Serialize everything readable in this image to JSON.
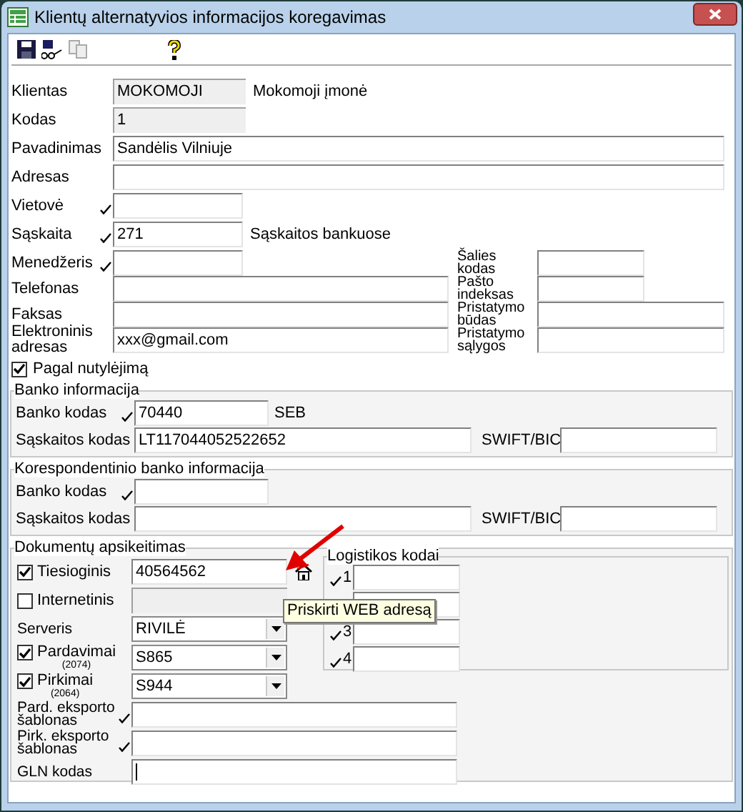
{
  "window": {
    "title": "Klientų alternatyvios informacijos koregavimas"
  },
  "main_fields": [
    {
      "label": "Klientas",
      "value": "MOKOMOJI",
      "disabled": true,
      "lookup": false,
      "note": "Mokomoji įmonė"
    },
    {
      "label": "Kodas",
      "value": "1",
      "disabled": true,
      "lookup": false
    },
    {
      "label": "Pavadinimas",
      "value": "Sandėlis Vilniuje",
      "disabled": false,
      "lookup": false
    },
    {
      "label": "Adresas",
      "disabled": false,
      "lookup": false
    },
    {
      "label": "Vietovė",
      "disabled": false,
      "lookup": true
    },
    {
      "label": "Sąskaita",
      "value": "271",
      "disabled": false,
      "lookup": true,
      "note": "Sąskaitos bankuose"
    }
  ],
  "left_fields": [
    {
      "label": "Menedžeris",
      "lookup": true
    },
    {
      "label": "Telefonas",
      "lookup": false
    },
    {
      "label": "Faksas",
      "lookup": false
    },
    {
      "label": "Elektroninis adresas",
      "value": "xxx@gmail.com",
      "lookup": false
    }
  ],
  "right_fields": [
    {
      "label": "Šalies kodas"
    },
    {
      "label": "Pašto indeksas"
    },
    {
      "label": "Pristatymo būdas"
    },
    {
      "label": "Pristatymo sąlygos"
    }
  ],
  "default_checkbox": {
    "label": "Pagal nutylėjimą",
    "checked": true
  },
  "bank_groups": [
    {
      "title": "Banko informacija",
      "bank_code": {
        "label": "Banko kodas",
        "value": "70440",
        "lookup": true,
        "note": "SEB"
      },
      "account": {
        "label": "Sąskaitos kodas",
        "value": "LT117044052522652"
      },
      "swift": {
        "label": "SWIFT/BIC"
      }
    },
    {
      "title": "Korespondentinio banko informacija",
      "bank_code": {
        "label": "Banko kodas",
        "lookup": true
      },
      "account": {
        "label": "Sąskaitos kodas"
      },
      "swift": {
        "label": "SWIFT/BIC"
      }
    }
  ],
  "documents": {
    "title": "Dokumentų apsikeitimas",
    "rows": [
      {
        "kind": "check",
        "label": "Tiesioginis",
        "checked": true,
        "value": "40564562",
        "disabled": false,
        "web_button": true
      },
      {
        "kind": "check",
        "label": "Internetinis",
        "checked": false,
        "disabled": true,
        "web_button": false
      },
      {
        "kind": "select",
        "label": "Serveris",
        "value": "RIVILĖ"
      },
      {
        "kind": "check_select",
        "label": "Pardavimai",
        "sub": "(2074)",
        "checked": true,
        "value": "S865"
      },
      {
        "kind": "check_select",
        "label": "Pirkimai",
        "sub": "(2064)",
        "checked": true,
        "value": "S944"
      },
      {
        "kind": "lookup",
        "label": "Pard. eksporto šablonas",
        "lookup": true
      },
      {
        "kind": "lookup",
        "label": "Pirk. eksporto šablonas",
        "lookup": true
      },
      {
        "kind": "lookup",
        "label": "GLN kodas",
        "lookup": false,
        "focused": true
      }
    ]
  },
  "logistics": {
    "title": "Logistikos kodai",
    "items": [
      {
        "kind": "code",
        "label": "1",
        "lookup": true
      },
      {
        "kind": "covered"
      },
      {
        "kind": "code",
        "label": "3",
        "lookup": true
      },
      {
        "kind": "code",
        "label": "4",
        "lookup": true
      }
    ]
  },
  "tooltip": {
    "text": "Priskirti WEB adresą"
  }
}
